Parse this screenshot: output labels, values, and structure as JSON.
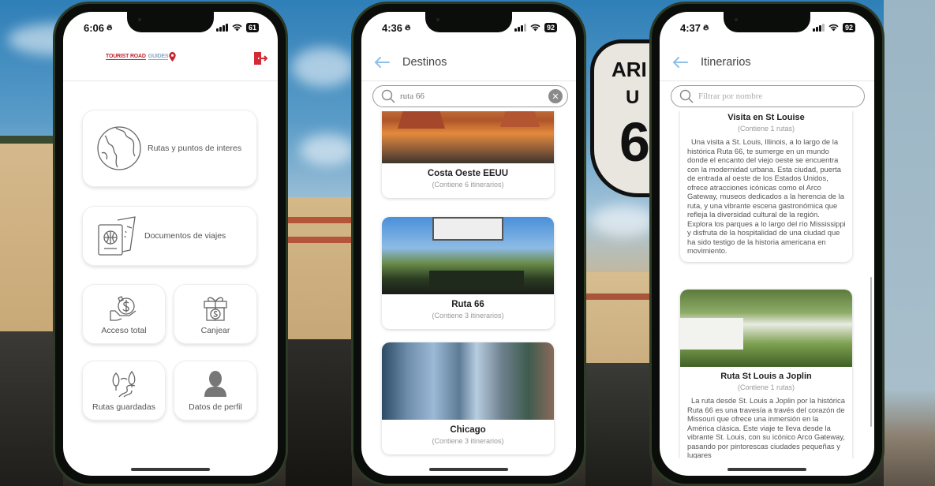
{
  "phones": [
    {
      "status": {
        "time": "6:06",
        "battery": "61"
      },
      "header": {
        "logo_text_1": "TOURIST ROAD",
        "logo_text_2": "GUIDES"
      },
      "menu": [
        {
          "label": "Rutas y puntos de interes",
          "icon": "globe-icon"
        },
        {
          "label": "Documentos de viajes",
          "icon": "passport-ticket-icon"
        },
        {
          "label": "Acceso total",
          "icon": "hand-money-icon"
        },
        {
          "label": "Canjear",
          "icon": "gift-coin-icon"
        },
        {
          "label": "Rutas guardadas",
          "icon": "trees-road-icon"
        },
        {
          "label": "Datos de perfil",
          "icon": "user-icon"
        }
      ]
    },
    {
      "status": {
        "time": "4:36",
        "battery": "92"
      },
      "header": {
        "title": "Destinos"
      },
      "search": {
        "value": "ruta 66",
        "placeholder": ""
      },
      "destinations": [
        {
          "name": "Costa Oeste EEUU",
          "count": "(Contiene 6 itinerarios)"
        },
        {
          "name": "Ruta 66",
          "count": "(Contiene 3 itinerarios)"
        },
        {
          "name": "Chicago",
          "count": "(Contiene 3 itinerarios)"
        }
      ]
    },
    {
      "status": {
        "time": "4:37",
        "battery": "92"
      },
      "header": {
        "title": "Itinerarios"
      },
      "search": {
        "value": "",
        "placeholder": "Filtrar por nombre"
      },
      "itineraries": [
        {
          "name": "Visita en St Louise",
          "count": "(Contiene 1 rutas)",
          "description": "Una visita a St. Louis, Illinois, a lo largo de la histórica Ruta 66, te sumerge en un mundo donde el encanto del viejo oeste se encuentra con la modernidad urbana. Esta ciudad, puerta de entrada al oeste de los Estados Unidos, ofrece atracciones icónicas como el Arco Gateway, museos dedicados a la herencia de la ruta, y una vibrante escena gastronómica que refleja la diversidad cultural de la región. Explora los parques a lo largo del río Mississippi y disfruta de la hospitalidad de una ciudad que ha sido testigo de la historia americana en movimiento."
        },
        {
          "name": "Ruta St Louis a Joplin",
          "count": "(Contiene 1 rutas)",
          "description": "La ruta desde St. Louis a Joplin por la histórica Ruta 66 es una travesía a través del corazón de Missouri que ofrece una inmersión en la América clásica. Este viaje te lleva desde la vibrante St. Louis, con su icónico Arco Gateway, pasando por pintorescas ciudades pequeñas y lugares"
        }
      ]
    }
  ],
  "colors": {
    "brand_red": "#c8222e",
    "back_arrow": "#8fbfe6"
  }
}
